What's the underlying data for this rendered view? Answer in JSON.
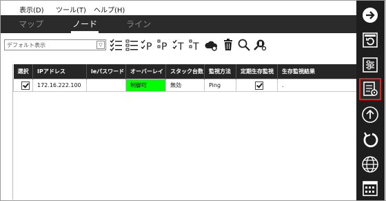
{
  "menu": {
    "view": "表示(D)",
    "tools": "ツール(T)",
    "help": "ヘルプ(H)"
  },
  "tabs": [
    "マップ",
    "ノード",
    "ライン"
  ],
  "active_tab": "ノード",
  "toolbar": {
    "view_select_value": "デフォルト表示",
    "tool_icons": [
      "list-check-icon",
      "list-icon",
      "check-ip-icon",
      "ip-icon",
      "check-t-icon",
      "t-icon",
      "cloud-settings-icon",
      "trash-icon",
      "search-icon",
      "search-settings-icon"
    ]
  },
  "grid": {
    "columns": [
      "選択",
      "IPアドレス",
      "leパスワード",
      "オーバーレイ",
      "スタック台数",
      "監視方法",
      "定期生存監視",
      "生存監視結果"
    ],
    "rows": [
      {
        "selected": true,
        "ip": "172.16.222.100",
        "password": "",
        "overlay": "制御可",
        "stack_count": "無効",
        "monitor_method": "Ping",
        "periodic_check": true,
        "result": "."
      }
    ]
  },
  "sidebar": {
    "buttons": [
      "arrow-right-circle-icon",
      "refresh-square-icon",
      "sliders-panel-icon",
      "node-settings-icon",
      "upload-circle-icon",
      "rotate-icon",
      "globe-icon",
      "grid-calendar-icon"
    ],
    "highlighted": "node-settings-icon"
  },
  "colors": {
    "dark": "#1e1e1e",
    "tabbar": "#2b2b2b",
    "header": "#262626",
    "green_cell": "#00ff00",
    "highlight": "#e52222"
  }
}
